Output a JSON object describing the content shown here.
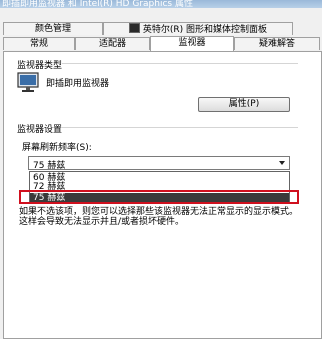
{
  "window": {
    "title": "即插即用监视器 和 Intel(R) HD Graphics 属性"
  },
  "tabs_row1": [
    {
      "label": "颜色管理"
    },
    {
      "label": "英特尔(R) 图形和媒体控制面板",
      "icon": "intel-graphics-icon"
    }
  ],
  "tabs_row2": [
    {
      "label": "常规"
    },
    {
      "label": "适配器"
    },
    {
      "label": "监视器"
    },
    {
      "label": "疑难解答"
    }
  ],
  "monitor_type": {
    "heading": "监视器类型",
    "icon": "monitor-icon",
    "name": "即插即用监视器",
    "properties_button": "属性(P)"
  },
  "monitor_settings": {
    "heading": "监视器设置",
    "refresh_label": "屏幕刷新频率(S):",
    "selected_value": "75 赫兹",
    "options": [
      "60 赫兹",
      "72 赫兹",
      "75 赫兹"
    ],
    "highlighted_option": "75 赫兹",
    "warning": "如果不选该项，则您可以选择那些该监视器无法正常显示的显示模式。这样会导致无法显示并且/或者损坏硬件。"
  },
  "colors": {
    "highlight_box": "#d0101e",
    "selection_bg": "#3a3a3a"
  }
}
